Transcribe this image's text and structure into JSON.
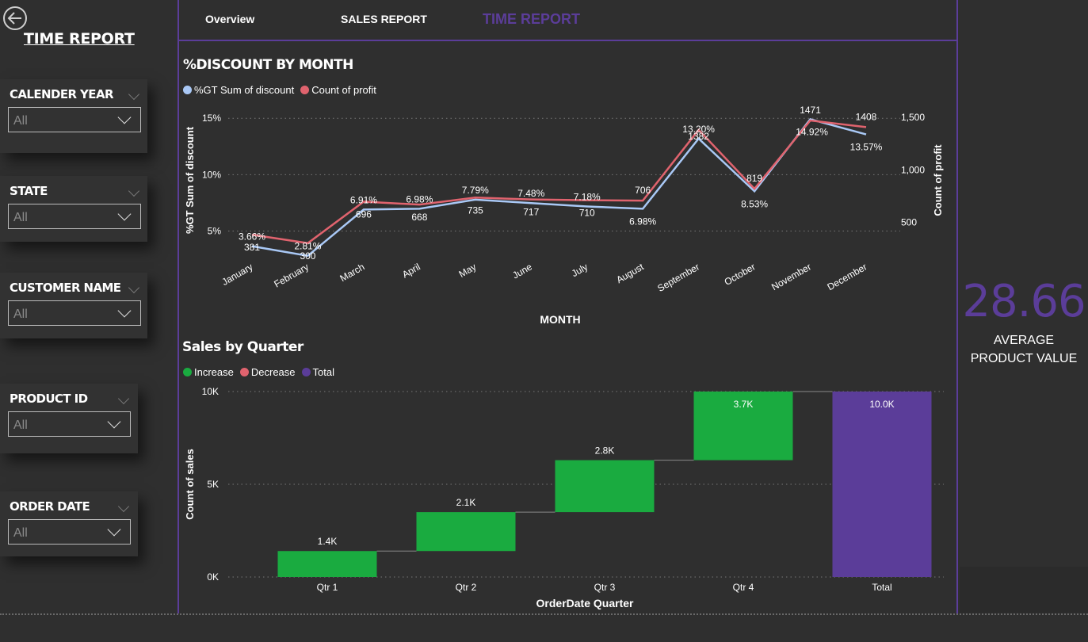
{
  "nav": {
    "tabs": [
      {
        "label": "Overview"
      },
      {
        "label": "SALES REPORT"
      },
      {
        "label": "TIME REPORT"
      }
    ]
  },
  "page_title": "TIME REPORT",
  "filters": [
    {
      "label": "CALENDER YEAR",
      "value": "All"
    },
    {
      "label": "STATE",
      "value": "All"
    },
    {
      "label": "CUSTOMER NAME",
      "value": "All"
    },
    {
      "label": "PRODUCT ID",
      "value": "All"
    },
    {
      "label": "ORDER DATE",
      "value": "All"
    }
  ],
  "kpi": {
    "value": "28.66",
    "label_line1": "AVERAGE",
    "label_line2": "PRODUCT VALUE"
  },
  "colors": {
    "accent": "#5b3d99",
    "discount_line": "#a9c8f5",
    "profit_line": "#e0636e",
    "increase": "#1aab40",
    "decrease": "#e0636e",
    "total": "#5b3d99"
  },
  "chart_data": [
    {
      "type": "line",
      "title": "%DISCOUNT BY MONTH",
      "xlabel": "MONTH",
      "ylabel": "%GT Sum of discount",
      "y2label": "Count of profit",
      "categories": [
        "January",
        "February",
        "March",
        "April",
        "May",
        "June",
        "July",
        "August",
        "September",
        "October",
        "November",
        "December"
      ],
      "y_ticks": [
        "5%",
        "10%",
        "15%"
      ],
      "y2_ticks": [
        "500",
        "1,000",
        "1,500"
      ],
      "ylim": [
        0.03,
        0.16
      ],
      "y2lim": [
        200,
        1600
      ],
      "series": [
        {
          "name": "%GT Sum of discount",
          "axis": "left",
          "values": [
            0.0366,
            0.0281,
            0.0691,
            0.0698,
            0.0779,
            0.0748,
            0.0718,
            0.0698,
            0.132,
            0.0853,
            0.1492,
            0.1357
          ],
          "labels": [
            "3.66%",
            "2.81%",
            "6.91%",
            "6.98%",
            "7.79%",
            "7.48%",
            "7.18%",
            "6.98%",
            "13.20%",
            "8.53%",
            "14.92%",
            "13.57%"
          ]
        },
        {
          "name": "Count of profit",
          "axis": "right",
          "values": [
            381,
            300,
            696,
            668,
            735,
            717,
            710,
            706,
            1382,
            819,
            1471,
            1408
          ],
          "labels": [
            "381",
            "300",
            "696",
            "668",
            "735",
            "717",
            "710",
            "706",
            "1382",
            "819",
            "1471",
            "1408"
          ]
        }
      ],
      "legend_position": "top-left",
      "grid": true
    },
    {
      "type": "waterfall",
      "title": "Sales by Quarter",
      "xlabel": "OrderDate Quarter",
      "ylabel": "Count of sales",
      "categories": [
        "Qtr 1",
        "Qtr 2",
        "Qtr 3",
        "Qtr 4",
        "Total"
      ],
      "values": [
        1400,
        2100,
        2800,
        3700,
        10000
      ],
      "labels": [
        "1.4K",
        "2.1K",
        "2.8K",
        "3.7K",
        "10.0K"
      ],
      "kinds": [
        "increase",
        "increase",
        "increase",
        "increase",
        "total"
      ],
      "y_ticks": [
        "0K",
        "5K",
        "10K"
      ],
      "ylim": [
        0,
        10000
      ],
      "legend": [
        "Increase",
        "Decrease",
        "Total"
      ],
      "legend_position": "top-left",
      "grid": true
    }
  ]
}
